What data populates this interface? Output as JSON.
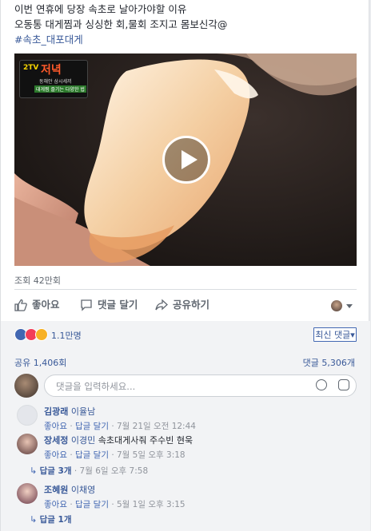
{
  "post": {
    "line1": "이번 연휴에 당장 속초로 날아가야할 이유",
    "line2": "오동통 대게찜과 싱싱한 회,물회 조지고 몸보신각@",
    "hashtag": "#속초_대포대게"
  },
  "video": {
    "logo_text": "2TV",
    "logo_title": "저녁",
    "logo_subtitle": "동해안 삼시세끼",
    "logo_banner": "대게찜 즐기는 다양한 법"
  },
  "stats": {
    "views": "조회 42만회"
  },
  "actions": {
    "like": "좋아요",
    "comment": "댓글 달기",
    "share": "공유하기"
  },
  "reactions": {
    "count": "1.1만명",
    "sort_label": "최신 댓글"
  },
  "counts": {
    "shares": "공유 1,406회",
    "comments": "댓글 5,306개"
  },
  "composer": {
    "placeholder": "댓글을 입력하세요..."
  },
  "comments": [
    {
      "name": "김광래",
      "tag": "이율남",
      "text": "",
      "like": "좋아요",
      "reply": "답글 달기",
      "time": "7월 21일 오전 12:44"
    },
    {
      "name": "장세정",
      "tag": "이경민",
      "text": "속초대게사줘 주수빈 현욱",
      "like": "좋아요",
      "reply": "답글 달기",
      "time": "7월 5일 오후 3:18",
      "replies": "답글 3개",
      "reply_time": "7월 6일 오후 7:58"
    },
    {
      "name": "조혜원",
      "tag": "이채영",
      "text": "",
      "like": "좋아요",
      "reply": "답글 달기",
      "time": "5월 1일 오후 3:15",
      "replies": "답글 1개"
    }
  ],
  "colors": {
    "link": "#385898",
    "brand": "#4267b2",
    "muted": "#606770",
    "bg": "#f2f3f5"
  }
}
